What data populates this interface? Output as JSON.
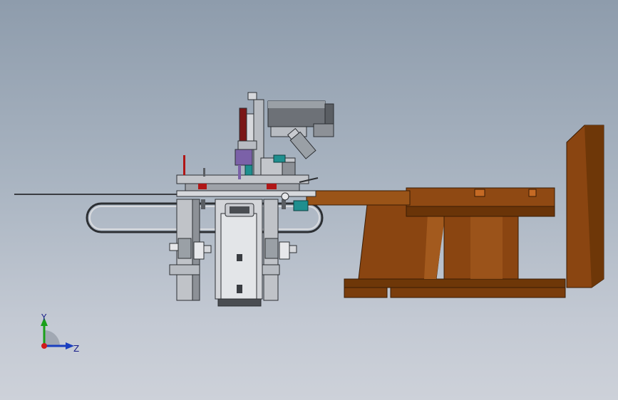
{
  "viewport": {
    "background_top": "#8e9cac",
    "background_bottom": "#cdd1d9"
  },
  "model": {
    "part_colors": {
      "frame": "#b8bcc2",
      "frame_dark": "#5a5e63",
      "bracket_wood": "#7a3d0c",
      "bracket_wood_light": "#9a5418",
      "accent_red": "#b01616",
      "accent_teal": "#1f8f8f",
      "accent_purple": "#7b61a8"
    },
    "icons": [
      "motor-icon",
      "cylinder-icon",
      "rail-icon"
    ]
  },
  "triad": {
    "y_label": "Y",
    "z_label": "Z",
    "colors": {
      "y": "#1aa01a",
      "z": "#1a3fc0",
      "x": "#d01a1a"
    }
  }
}
